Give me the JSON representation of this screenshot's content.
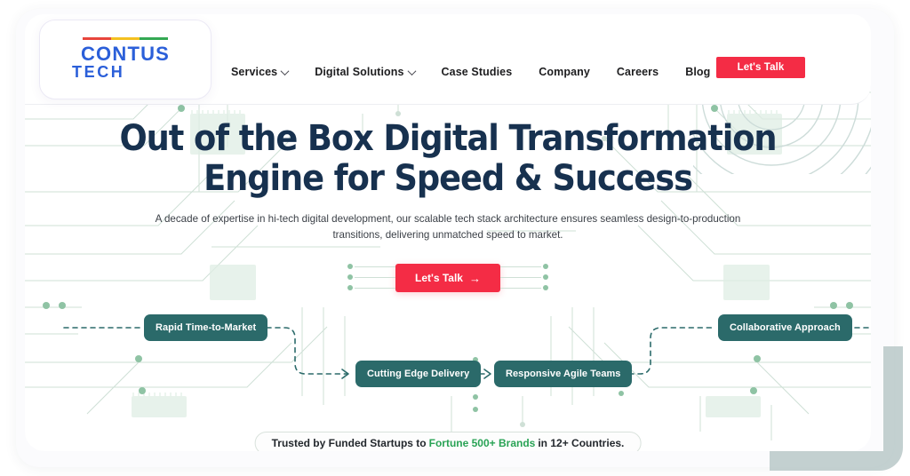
{
  "brand": {
    "logo_word": "CONTUS",
    "logo_sub": "TECH",
    "bar_colors": [
      "#e8453c",
      "#f4c020",
      "#34a853"
    ],
    "logo_color": "#2b5fd9"
  },
  "nav": {
    "items": [
      {
        "label": "Services",
        "has_dropdown": true,
        "icon": "chevron-down-icon"
      },
      {
        "label": "Digital Solutions",
        "has_dropdown": true,
        "icon": "chevron-down-icon"
      },
      {
        "label": "Case Studies",
        "has_dropdown": false
      },
      {
        "label": "Company",
        "has_dropdown": false
      },
      {
        "label": "Careers",
        "has_dropdown": false
      },
      {
        "label": "Blog",
        "has_dropdown": false
      }
    ],
    "cta_label": "Let's Talk",
    "cta_color": "#f42c45"
  },
  "hero": {
    "headline_line1": "Out of the Box Digital Transformation",
    "headline_line2": "Engine for Speed & Success",
    "headline_color": "#17314f",
    "subtitle": "A decade of expertise in hi-tech digital development, our scalable tech stack architecture ensures seamless design-to-production transitions, delivering unmatched speed to market.",
    "cta_label": "Let's Talk",
    "cta_arrow": "→",
    "cta_color": "#f42c45"
  },
  "tags": [
    {
      "label": "Rapid Time-to-Market"
    },
    {
      "label": "Cutting Edge Delivery"
    },
    {
      "label": "Responsive Agile Teams"
    },
    {
      "label": "Collaborative Approach"
    }
  ],
  "tag_color": "#2b6a6a",
  "trust": {
    "prefix": "Trusted by Funded Startups to",
    "highlight": "Fortune 500+ Brands",
    "suffix": "in 12+ Countries.",
    "highlight_color": "#29a355"
  },
  "decor": {
    "circuit_line_color": "#cfe0d6",
    "circuit_dot_color": "#8fc3a4",
    "chip_color": "#dfeee4",
    "ring_color": "#cddcd9",
    "blob_color": "#b8c8c8"
  }
}
